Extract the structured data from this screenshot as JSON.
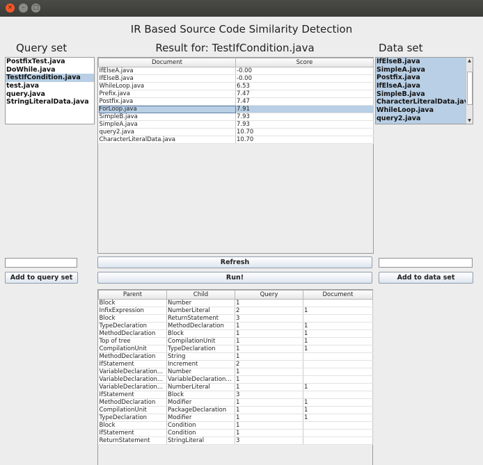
{
  "window": {
    "close_glyph": "×",
    "minimize_glyph": "–",
    "maximize_glyph": "□"
  },
  "app_title": "IR Based Source Code Similarity Detection",
  "query_set": {
    "heading": "Query set",
    "items": [
      {
        "label": "PostfixTest.java",
        "selected": false
      },
      {
        "label": "DoWhile.java",
        "selected": false
      },
      {
        "label": "TestIfCondition.java",
        "selected": true
      },
      {
        "label": "test.java",
        "selected": false
      },
      {
        "label": "query.java",
        "selected": false
      },
      {
        "label": "StringLiteralData.java",
        "selected": false
      }
    ],
    "input_value": "",
    "add_button": "Add to query set"
  },
  "result": {
    "heading": "Result for: TestIfCondition.java",
    "columns": [
      "Document",
      "Score"
    ],
    "rows": [
      {
        "document": "IfElseA.java",
        "score": "-0.00"
      },
      {
        "document": "IfElseB.java",
        "score": "-0.00"
      },
      {
        "document": "WhileLoop.java",
        "score": "6.53"
      },
      {
        "document": "Prefix.java",
        "score": "7.47"
      },
      {
        "document": "Postfix.java",
        "score": "7.47"
      },
      {
        "document": "ForLoop.java",
        "score": "7.91",
        "selected": true
      },
      {
        "document": "SimpleB.java",
        "score": "7.93"
      },
      {
        "document": "SimpleA.java",
        "score": "7.93"
      },
      {
        "document": "query2.java",
        "score": "10.70"
      },
      {
        "document": "CharacterLiteralData.java",
        "score": "10.70"
      }
    ]
  },
  "data_set": {
    "heading": "Data set",
    "items": [
      "IfElseB.java",
      "SimpleA.java",
      "Postfix.java",
      "IfElseA.java",
      "SimpleB.java",
      "CharacterLiteralData.java",
      "WhileLoop.java",
      "query2.java"
    ],
    "scroll_up_glyph": "▲",
    "scroll_down_glyph": "▼",
    "input_value": "",
    "add_button": "Add to data set"
  },
  "buttons": {
    "refresh": "Refresh",
    "run": "Run!"
  },
  "details": {
    "columns": [
      "Parent",
      "Child",
      "Query",
      "Document"
    ],
    "rows": [
      [
        "Block",
        "Number",
        "1",
        ""
      ],
      [
        "InfixExpression",
        "NumberLiteral",
        "2",
        "1"
      ],
      [
        "Block",
        "ReturnStatement",
        "3",
        ""
      ],
      [
        "TypeDeclaration",
        "MethodDeclaration",
        "1",
        "1"
      ],
      [
        "MethodDeclaration",
        "Block",
        "1",
        "1"
      ],
      [
        "Top of tree",
        "CompilationUnit",
        "1",
        "1"
      ],
      [
        "CompilationUnit",
        "TypeDeclaration",
        "1",
        "1"
      ],
      [
        "MethodDeclaration",
        "String",
        "1",
        ""
      ],
      [
        "IfStatement",
        "Increment",
        "2",
        ""
      ],
      [
        "VariableDeclaration...",
        "Number",
        "1",
        ""
      ],
      [
        "VariableDeclaration...",
        "VariableDeclaration...",
        "1",
        ""
      ],
      [
        "VariableDeclaration...",
        "NumberLiteral",
        "1",
        "1"
      ],
      [
        "IfStatement",
        "Block",
        "3",
        ""
      ],
      [
        "MethodDeclaration",
        "Modifier",
        "1",
        "1"
      ],
      [
        "CompilationUnit",
        "PackageDeclaration",
        "1",
        "1"
      ],
      [
        "TypeDeclaration",
        "Modifier",
        "1",
        "1"
      ],
      [
        "Block",
        "Condition",
        "1",
        ""
      ],
      [
        "IfStatement",
        "Condition",
        "1",
        ""
      ],
      [
        "ReturnStatement",
        "StringLiteral",
        "3",
        ""
      ]
    ]
  }
}
